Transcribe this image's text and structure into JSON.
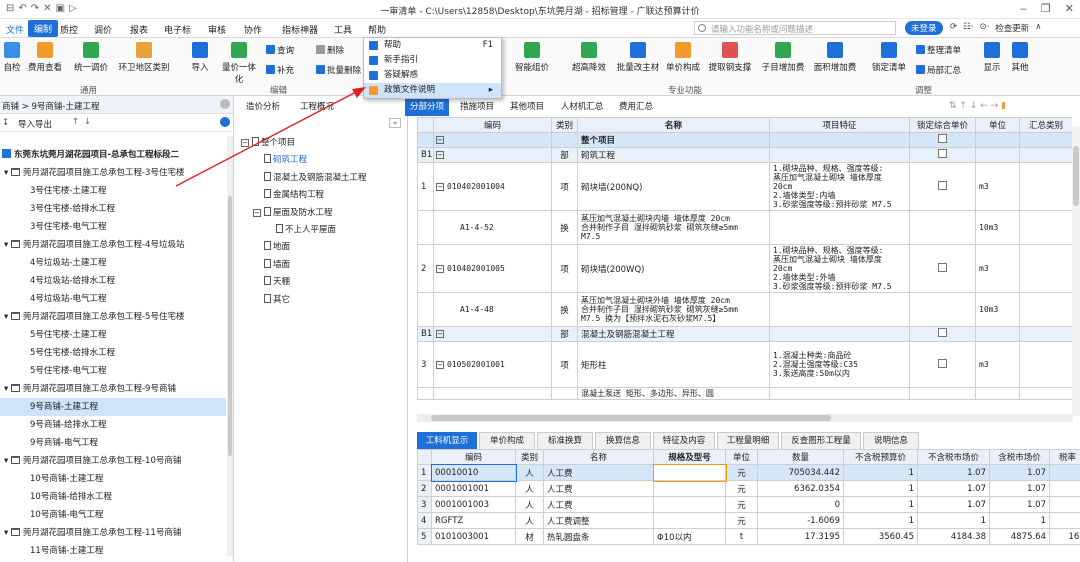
{
  "window": {
    "title": "一审清单 - C:\\Users\\12858\\Desktop\\东坑莞月湖 - 招标管理 - 广联达预算计价",
    "qat": [
      "⊟",
      "↶",
      "↷",
      "✕",
      "▣",
      "▷"
    ],
    "controls": [
      "‒",
      "❐",
      "✕"
    ]
  },
  "menu": {
    "items": [
      "文件",
      "编制",
      "质控",
      "调价",
      "报表",
      "电子标",
      "审核",
      "协作",
      "指标神器",
      "工具",
      "帮助"
    ],
    "active": "编制",
    "search_placeholder": "请输入功能名称或问题描述",
    "login": "未登录",
    "right_items": [
      "⟳",
      "☷·",
      "⊙·",
      "检查更新",
      "∧"
    ]
  },
  "ribbon": {
    "left_buttons": [
      "自检",
      "费用查看",
      "统一调价",
      "环卫地区类别"
    ],
    "left_group": "通用",
    "mid_buttons": [
      "导入",
      "量价一体化"
    ],
    "small1": [
      "查询",
      "补充"
    ],
    "small2": [
      "删除",
      "批量删除"
    ],
    "mid_group": "编辑",
    "pro_buttons": [
      "智能组价",
      "超高降效",
      "批量改主材",
      "单价构成",
      "提取钢支撑",
      "子目增加费",
      "面积增加费",
      "锁定清单",
      "整理清单",
      "局部汇总",
      "显示",
      "其他"
    ],
    "pro_group": "专业功能",
    "adjust_group": "调整"
  },
  "help_menu": {
    "items": [
      {
        "label": "帮助",
        "key": "F1"
      },
      {
        "label": "新手指引",
        "key": ""
      },
      {
        "label": "答疑解惑",
        "key": ""
      },
      {
        "label": "政策文件说明",
        "key": "▸"
      }
    ],
    "highlighted": "政策文件说明"
  },
  "left_panel": {
    "breadcrumb": "商铺 > 9号商铺-土建工程",
    "import_label": "导入导出",
    "project": "东莞东坑莞月湖花园项目-总承包工程标段二",
    "tree": [
      {
        "text": "莞月湖花园项目施工总承包工程-3号住宅楼",
        "level": 0,
        "group": true
      },
      {
        "text": "3号住宅楼-土建工程",
        "level": 1
      },
      {
        "text": "3号住宅楼-给排水工程",
        "level": 1
      },
      {
        "text": "3号住宅楼-电气工程",
        "level": 1
      },
      {
        "text": "莞月湖花园项目施工总承包工程-4号垃圾站",
        "level": 0,
        "group": true
      },
      {
        "text": "4号垃圾站-土建工程",
        "level": 1
      },
      {
        "text": "4号垃圾站-给排水工程",
        "level": 1
      },
      {
        "text": "4号垃圾站-电气工程",
        "level": 1
      },
      {
        "text": "莞月湖花园项目施工总承包工程-5号住宅楼",
        "level": 0,
        "group": true
      },
      {
        "text": "5号住宅楼-土建工程",
        "level": 1
      },
      {
        "text": "5号住宅楼-给排水工程",
        "level": 1
      },
      {
        "text": "5号住宅楼-电气工程",
        "level": 1
      },
      {
        "text": "莞月湖花园项目施工总承包工程-9号商铺",
        "level": 0,
        "group": true
      },
      {
        "text": "9号商铺-土建工程",
        "level": 1,
        "selected": true
      },
      {
        "text": "9号商铺-给排水工程",
        "level": 1
      },
      {
        "text": "9号商铺-电气工程",
        "level": 1
      },
      {
        "text": "莞月湖花园项目施工总承包工程-10号商铺",
        "level": 0,
        "group": true
      },
      {
        "text": "10号商铺-土建工程",
        "level": 1
      },
      {
        "text": "10号商铺-给排水工程",
        "level": 1
      },
      {
        "text": "10号商铺-电气工程",
        "level": 1
      },
      {
        "text": "莞月湖花园项目施工总承包工程-11号商铺",
        "level": 0,
        "group": true
      },
      {
        "text": "11号商铺-土建工程",
        "level": 1
      }
    ]
  },
  "mid_panel": {
    "tabs": [
      "造价分析",
      "工程概况",
      "分部分项",
      "措施项目",
      "其他项目",
      "人材机汇总",
      "费用汇总"
    ],
    "active_tab": "分部分项",
    "tree": [
      {
        "text": "整个项目",
        "level": 0,
        "box": "−"
      },
      {
        "text": "砌筑工程",
        "level": 1,
        "active": true
      },
      {
        "text": "混凝土及钢筋混凝土工程",
        "level": 1
      },
      {
        "text": "金属结构工程",
        "level": 1
      },
      {
        "text": "屋面及防水工程",
        "level": 1,
        "box": "−"
      },
      {
        "text": "不上人平屋面",
        "level": 2
      },
      {
        "text": "地面",
        "level": 1
      },
      {
        "text": "墙面",
        "level": 1
      },
      {
        "text": "天棚",
        "level": 1
      },
      {
        "text": "其它",
        "level": 1
      }
    ]
  },
  "main_table": {
    "headers": [
      "编码",
      "类别",
      "名称",
      "项目特征",
      "锁定综合单价",
      "单位",
      "汇总类别"
    ],
    "rows": [
      {
        "no": "",
        "code": "",
        "type": "",
        "name": "整个项目",
        "feature": "",
        "unit": "",
        "kind": "header"
      },
      {
        "no": "B1",
        "code": "",
        "type": "部",
        "name": "砌筑工程",
        "feature": "",
        "unit": "",
        "kind": "section"
      },
      {
        "no": "1",
        "code": "010402001004",
        "type": "项",
        "name": "砌块墙(200NQ)",
        "feature": "1.砌块品种、规格、强度等级:\n蒸压加气混凝土砌块 墙体厚度\n20cm\n2.墙体类型:内墙\n3.砂浆强度等级:预拌砂浆 M7.5",
        "unit": "m3",
        "kind": "item"
      },
      {
        "no": "",
        "code": "A1-4-52",
        "type": "换",
        "name": "蒸压加气混凝土砌块内墙 墙体厚度 20cm\n合并制作子目 湿拌砌筑砂浆 砌筑灰缝≥5mm\nM7.5",
        "feature": "",
        "unit": "10m3",
        "kind": "sub"
      },
      {
        "no": "2",
        "code": "010402001005",
        "type": "项",
        "name": "砌块墙(200WQ)",
        "feature": "1.砌块品种、规格、强度等级:\n蒸压加气混凝土砌块 墙体厚度\n20cm\n2.墙体类型:外墙\n3.砂浆强度等级:预拌砂浆 M7.5",
        "unit": "m3",
        "kind": "item"
      },
      {
        "no": "",
        "code": "A1-4-48",
        "type": "换",
        "name": "蒸压加气混凝土砌块外墙 墙体厚度 20cm\n合并制作子目 湿拌砌筑砂浆 砌筑灰缝≥5mm\nM7.5  换为【预拌水泥石灰砂浆M7.5】",
        "feature": "",
        "unit": "10m3",
        "kind": "sub"
      },
      {
        "no": "B1",
        "code": "",
        "type": "部",
        "name": "混凝土及钢筋混凝土工程",
        "feature": "",
        "unit": "",
        "kind": "section"
      },
      {
        "no": "3",
        "code": "010502001001",
        "type": "项",
        "name": "矩形柱",
        "feature": "1.混凝土种类:商品砼\n2.混凝土强度等级:C35\n3.泵送高度:50m以内",
        "unit": "m3",
        "kind": "item"
      },
      {
        "no": "",
        "code": "",
        "type": "",
        "name": "混凝土泵送 矩形、多边形、异形、圆",
        "feature": "",
        "unit": "",
        "kind": "cut"
      }
    ]
  },
  "bottom_tabs": {
    "items": [
      "工料机显示",
      "单价构成",
      "标准换算",
      "换算信息",
      "特征及内容",
      "工程量明细",
      "反查图形工程量",
      "说明信息"
    ],
    "active": "工料机显示"
  },
  "bottom_table": {
    "headers": [
      "编码",
      "类别",
      "名称",
      "规格及型号",
      "单位",
      "数量",
      "不含税预算价",
      "不含税市场价",
      "含税市场价",
      "税率"
    ],
    "rows": [
      [
        "00010010",
        "人",
        "人工费",
        "",
        "元",
        "705034.442",
        "1",
        "1.07",
        "1.07",
        ""
      ],
      [
        "0001001001",
        "人",
        "人工费",
        "",
        "元",
        "6362.0354",
        "1",
        "1.07",
        "1.07",
        ""
      ],
      [
        "0001001003",
        "人",
        "人工费",
        "",
        "元",
        "0",
        "1",
        "1.07",
        "1.07",
        ""
      ],
      [
        "RGFTZ",
        "人",
        "人工费调整",
        "",
        "元",
        "-1.6069",
        "1",
        "1",
        "1",
        ""
      ],
      [
        "0101003001",
        "材",
        "热轧圆盘条",
        "Φ10以内",
        "t",
        "17.3195",
        "3560.45",
        "4184.38",
        "4875.64",
        "16."
      ]
    ]
  }
}
